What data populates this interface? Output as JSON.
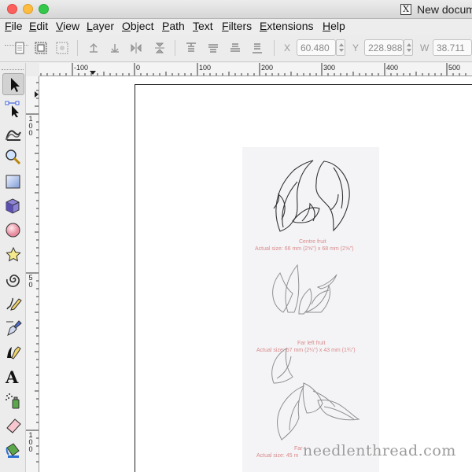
{
  "window": {
    "title": "New docum",
    "app_icon_glyph": "X"
  },
  "menu": {
    "items": [
      "File",
      "Edit",
      "View",
      "Layer",
      "Object",
      "Path",
      "Text",
      "Filters",
      "Extensions",
      "Help"
    ]
  },
  "controls": {
    "x_label": "X",
    "x_value": "60.480",
    "y_label": "Y",
    "y_value": "228.988",
    "w_label": "W",
    "w_value": "38.711"
  },
  "ruler": {
    "h_labels": [
      "-100",
      "0",
      "100",
      "200",
      "300",
      "400",
      "500"
    ],
    "v_labels": [
      "100",
      "50",
      "0"
    ]
  },
  "toolbox": {
    "tools": [
      "selector-tool",
      "node-tool",
      "tweak-tool",
      "zoom-tool",
      "rectangle-tool",
      "3d-box-tool",
      "ellipse-tool",
      "star-tool",
      "spiral-tool",
      "pencil-tool",
      "pen-tool",
      "calligraphy-tool",
      "text-tool",
      "spray-tool",
      "eraser-tool",
      "paint-bucket-tool"
    ],
    "active": "selector-tool"
  },
  "document": {
    "captions": [
      {
        "title": "Centre fruit",
        "size": "Actual size: 66 mm (2⅝\") x 68 mm (2⅝\")"
      },
      {
        "title": "Far left fruit",
        "size": "Actual size: 57 mm (2¼\") x 43 mm (1¾\")"
      },
      {
        "title": "Far r",
        "size": "Actual size: 45 m"
      }
    ],
    "watermark": "needlenthread.com"
  },
  "colors": {
    "caption": "#d98a8a",
    "close": "#fc605c",
    "minimize": "#fdbc40",
    "zoom": "#34c84a"
  }
}
